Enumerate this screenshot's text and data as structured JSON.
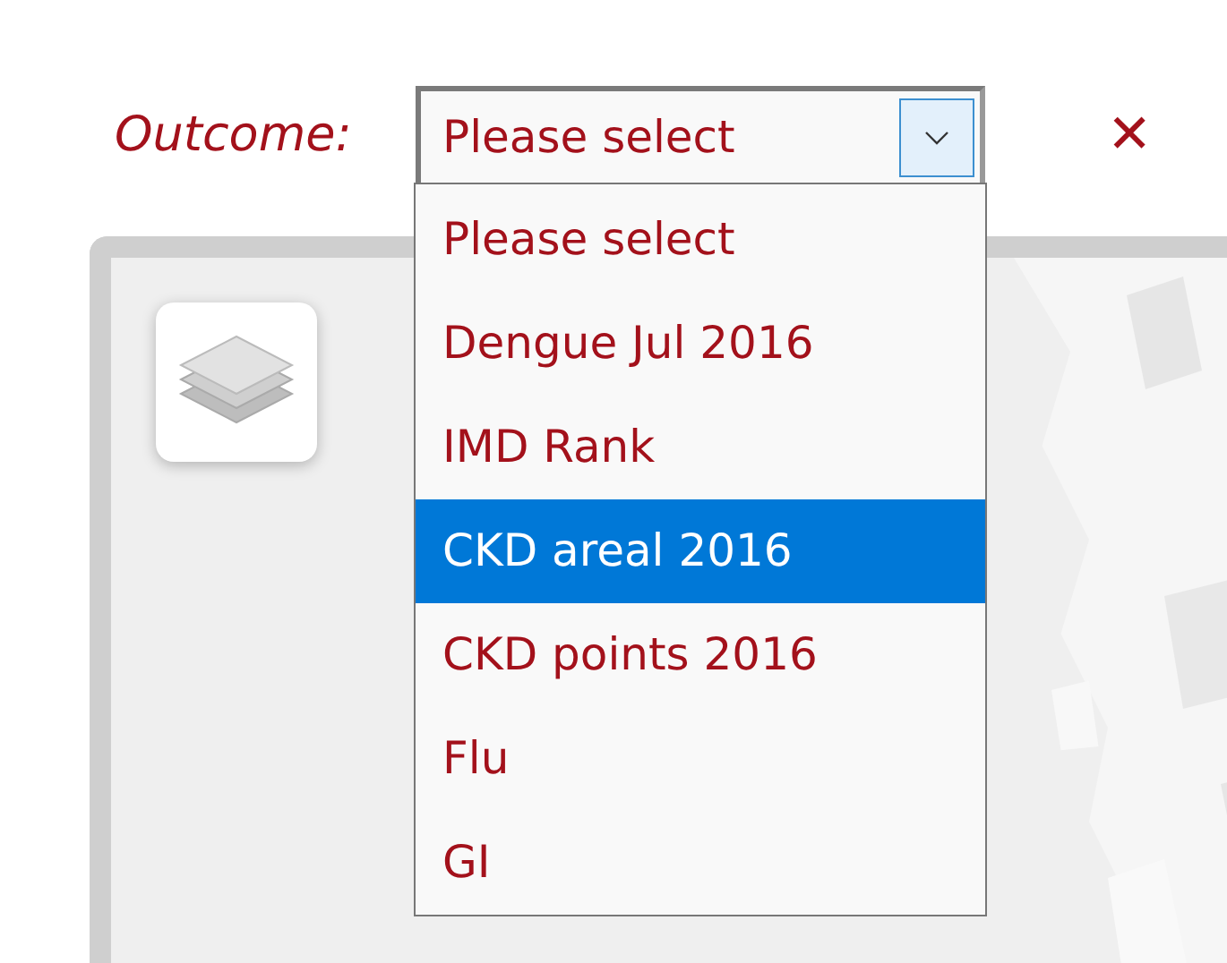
{
  "outcome": {
    "label": "Outcome:",
    "value": "Please select",
    "expanded": true,
    "options": [
      {
        "label": "Please select",
        "highlighted": false
      },
      {
        "label": "Dengue Jul 2016",
        "highlighted": false
      },
      {
        "label": "IMD Rank",
        "highlighted": false
      },
      {
        "label": "CKD areal 2016",
        "highlighted": true
      },
      {
        "label": "CKD points 2016",
        "highlighted": false
      },
      {
        "label": "Flu",
        "highlighted": false
      },
      {
        "label": "GI",
        "highlighted": false
      }
    ]
  },
  "close": {
    "symbol": "✕"
  }
}
